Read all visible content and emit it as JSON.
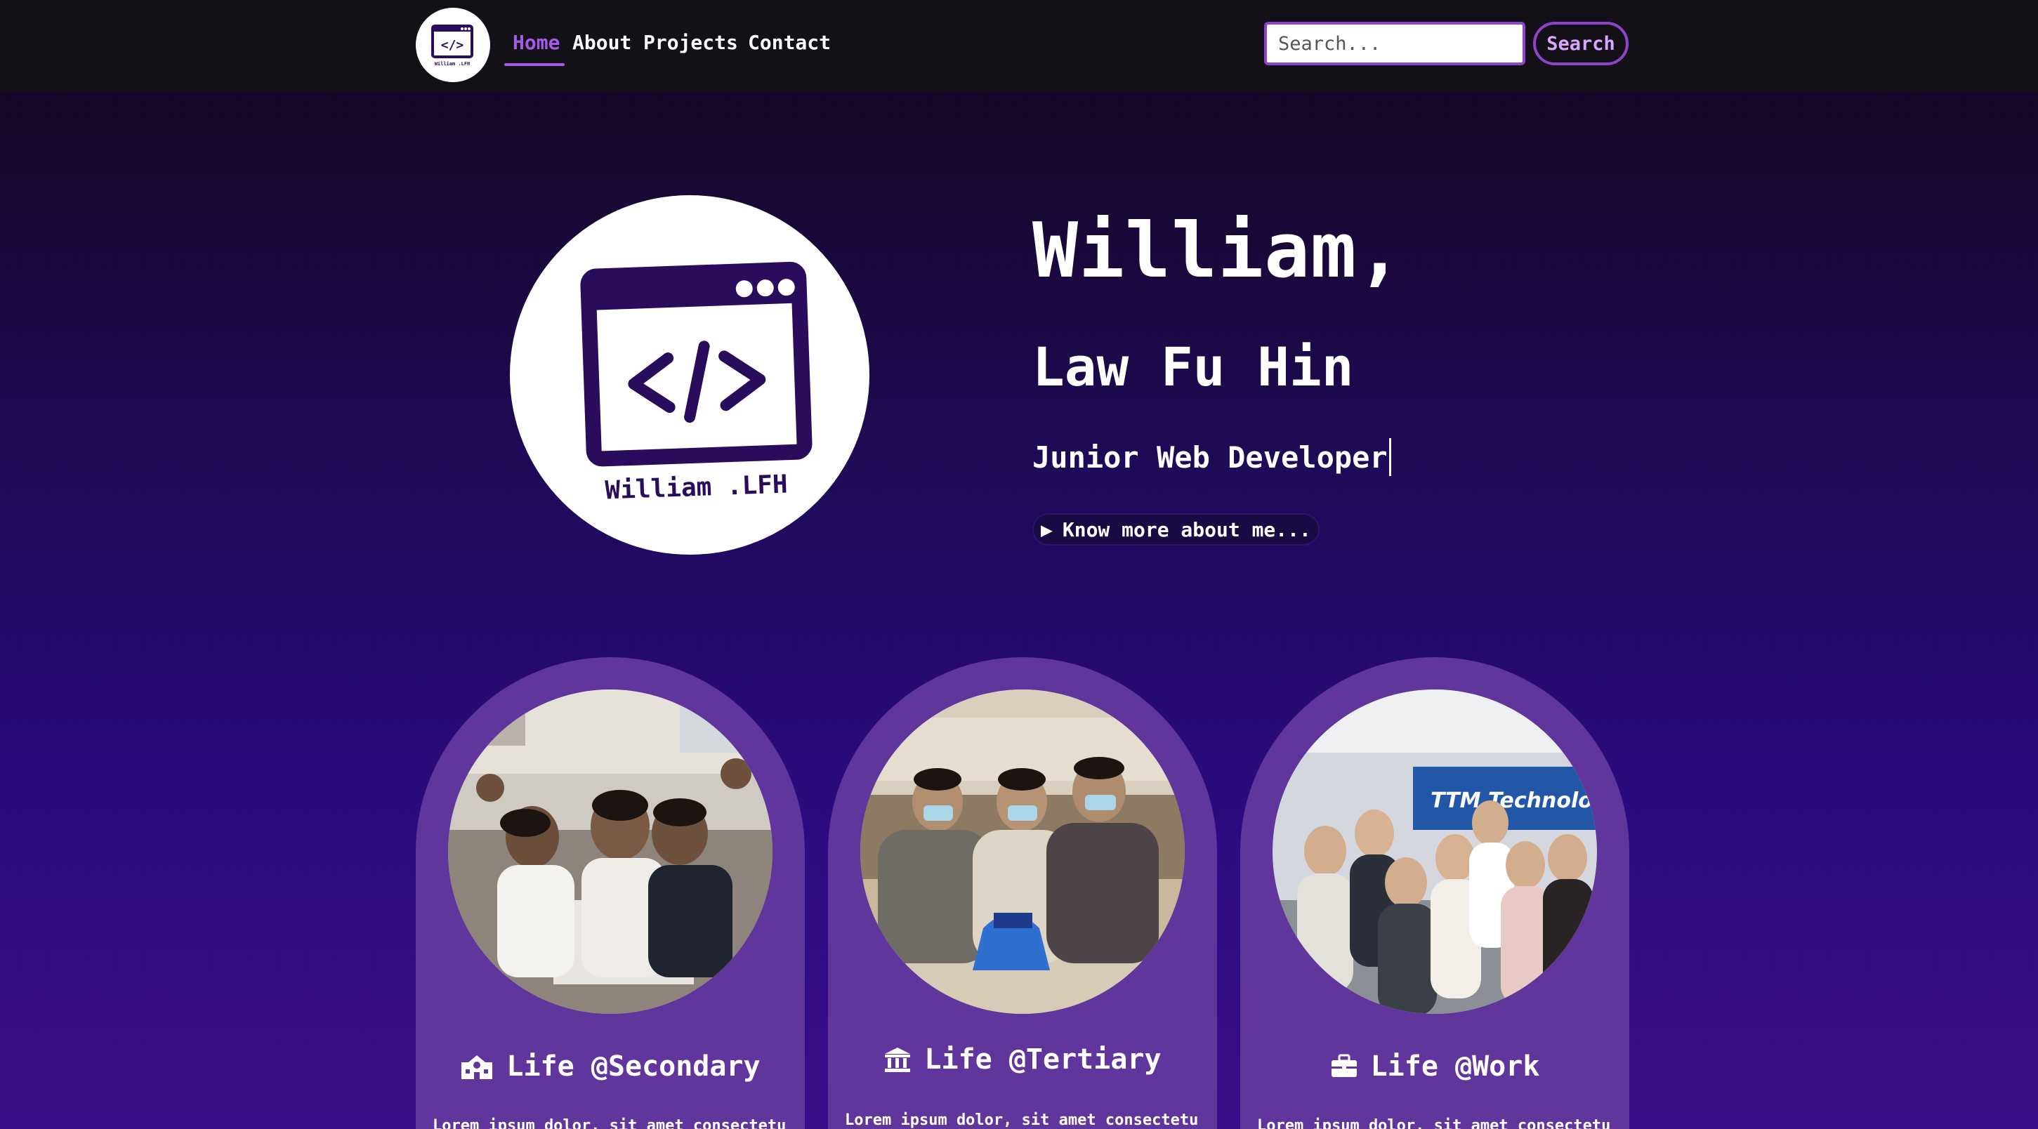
{
  "nav": {
    "logo_alt": "William .LFH logo",
    "links": [
      "Home",
      "About",
      "Projects",
      "Contact"
    ],
    "active": "Home",
    "search_placeholder": "Search...",
    "search_button": "Search"
  },
  "hero": {
    "logo_code": "</>",
    "logo_text": "William .LFH",
    "name": "William,",
    "fullname": "Law Fu Hin",
    "role": "Junior Web Developer",
    "cta_arrow": "▶",
    "cta": "Know more about me..."
  },
  "cards": [
    {
      "icon": "school-icon",
      "title": "Life @Secondary",
      "text": "Lorem ipsum dolor, sit amet consectetur"
    },
    {
      "icon": "university-icon",
      "title": "Life @Tertiary",
      "text": "Lorem ipsum dolor, sit amet consectetur"
    },
    {
      "icon": "briefcase-icon",
      "title": "Life @Work",
      "text": "Lorem ipsum dolor, sit amet consectetur"
    }
  ],
  "photo_captions": {
    "work_banner": "TTM Technologies"
  },
  "colors": {
    "accent": "#a45ce6",
    "nav_bg": "#141018",
    "card_bg": "#61369c",
    "logo_ink": "#2a0c5c"
  }
}
